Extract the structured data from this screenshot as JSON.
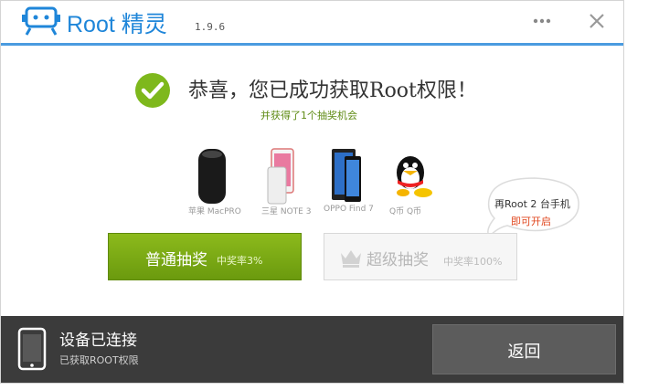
{
  "titlebar": {
    "app_name": "Root 精灵",
    "version": "1.9.6",
    "brand_color": "#1f86d9"
  },
  "result": {
    "headline": "恭喜，您已成功获取Root权限！",
    "subline": "并获得了1个抽奖机会"
  },
  "prizes": [
    {
      "icon": "mac-pro-icon",
      "label": "苹果 MacPRO"
    },
    {
      "icon": "galaxy-note-phone-icon",
      "label": "三星 NOTE 3"
    },
    {
      "icon": "oppo-find-phone-icon",
      "label": "OPPO Find 7"
    },
    {
      "icon": "qq-penguin-icon",
      "label": "Q币 Q币"
    }
  ],
  "bubble": {
    "line1": "再Root 2 台手机",
    "line2": "即可开启"
  },
  "buttons": {
    "normal": {
      "label": "普通抽奖",
      "rate": "中奖率3%"
    },
    "super": {
      "label": "超级抽奖",
      "rate": "中奖率100%"
    }
  },
  "footer": {
    "status_main": "设备已连接",
    "status_sub": "已获取ROOT权限",
    "back_label": "返回"
  }
}
